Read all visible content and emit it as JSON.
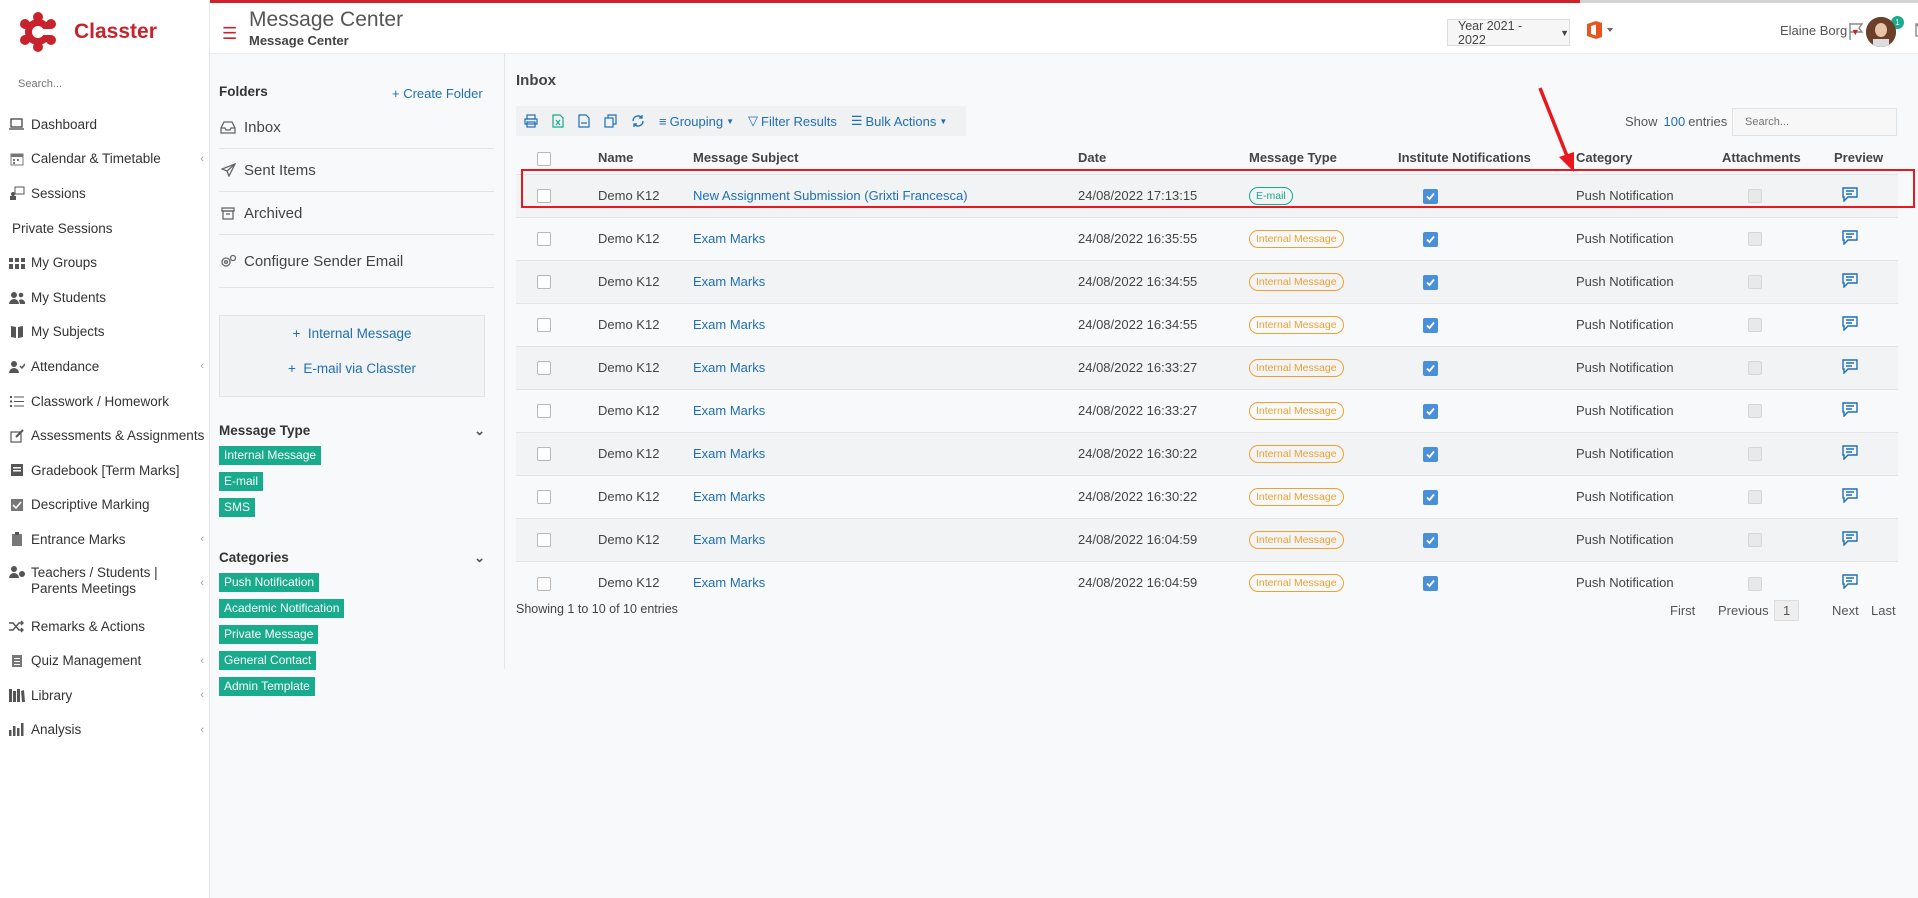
{
  "app": {
    "name": "Classter"
  },
  "sidebar": {
    "search_placeholder": "Search...",
    "items": [
      {
        "label": "Dashboard",
        "icon": "laptop-icon",
        "chevron": false
      },
      {
        "label": "Calendar & Timetable",
        "icon": "calendar-icon",
        "chevron": true
      },
      {
        "label": "Sessions",
        "icon": "presentation-icon",
        "chevron": false
      },
      {
        "label": "Private Sessions",
        "icon": "",
        "chevron": false
      },
      {
        "label": "My Groups",
        "icon": "groups-icon",
        "chevron": false
      },
      {
        "label": "My Students",
        "icon": "users-icon",
        "chevron": false
      },
      {
        "label": "My Subjects",
        "icon": "book-icon",
        "chevron": false
      },
      {
        "label": "Attendance",
        "icon": "attendance-icon",
        "chevron": true
      },
      {
        "label": "Classwork / Homework",
        "icon": "list-icon",
        "chevron": false
      },
      {
        "label": "Assessments & Assignments",
        "icon": "edit-icon",
        "chevron": false
      },
      {
        "label": "Gradebook [Term Marks]",
        "icon": "gradebook-icon",
        "chevron": false
      },
      {
        "label": "Descriptive Marking",
        "icon": "check-square-icon",
        "chevron": false
      },
      {
        "label": "Entrance Marks",
        "icon": "clipboard-icon",
        "chevron": true
      },
      {
        "label": "Teachers / Students | Parents Meetings",
        "icon": "meeting-icon",
        "chevron": true
      },
      {
        "label": "Remarks & Actions",
        "icon": "shuffle-icon",
        "chevron": false
      },
      {
        "label": "Quiz Management",
        "icon": "quiz-icon",
        "chevron": true
      },
      {
        "label": "Library",
        "icon": "library-icon",
        "chevron": true
      },
      {
        "label": "Analysis",
        "icon": "bar-chart-icon",
        "chevron": true
      }
    ]
  },
  "header": {
    "title": "Message Center",
    "subtitle": "Message Center",
    "year": "Year 2021 - 2022",
    "notifications_count": "1",
    "messages_count": "0",
    "user_name": "Elaine Borg"
  },
  "folders": {
    "title": "Folders",
    "create_label": "Create Folder",
    "items": [
      {
        "label": "Inbox",
        "icon": "inbox-icon"
      },
      {
        "label": "Sent Items",
        "icon": "send-icon"
      },
      {
        "label": "Archived",
        "icon": "archive-icon"
      },
      {
        "label": "Configure Sender Email",
        "icon": "gears-icon"
      }
    ],
    "new_internal": "Internal Message",
    "new_email": "E-mail via Classter",
    "message_type_title": "Message Type",
    "message_types": [
      "Internal Message",
      "E-mail",
      "SMS"
    ],
    "categories_title": "Categories",
    "categories": [
      "Push Notification",
      "Academic Notification",
      "Private Message",
      "General Contact",
      "Admin Template"
    ]
  },
  "inbox": {
    "title": "Inbox",
    "toolbar": {
      "grouping": "Grouping",
      "filter": "Filter Results",
      "bulk": "Bulk Actions"
    },
    "show_label": "Show",
    "show_value": "100",
    "entries_label": "entries",
    "search_placeholder": "Search...",
    "columns": [
      "Name",
      "Message Subject",
      "Date",
      "Message Type",
      "Institute Notifications",
      "Category",
      "Attachments",
      "Preview"
    ],
    "rows": [
      {
        "name": "Demo K12",
        "subject": "New Assignment Submission (Grixti Francesca)",
        "date": "24/08/2022 17:13:15",
        "type": "E-mail",
        "kind": "email",
        "category": "Push Notification"
      },
      {
        "name": "Demo K12",
        "subject": "Exam Marks",
        "date": "24/08/2022 16:35:55",
        "type": "Internal Message",
        "kind": "internal",
        "category": "Push Notification"
      },
      {
        "name": "Demo K12",
        "subject": "Exam Marks",
        "date": "24/08/2022 16:34:55",
        "type": "Internal Message",
        "kind": "internal",
        "category": "Push Notification"
      },
      {
        "name": "Demo K12",
        "subject": "Exam Marks",
        "date": "24/08/2022 16:34:55",
        "type": "Internal Message",
        "kind": "internal",
        "category": "Push Notification"
      },
      {
        "name": "Demo K12",
        "subject": "Exam Marks",
        "date": "24/08/2022 16:33:27",
        "type": "Internal Message",
        "kind": "internal",
        "category": "Push Notification"
      },
      {
        "name": "Demo K12",
        "subject": "Exam Marks",
        "date": "24/08/2022 16:33:27",
        "type": "Internal Message",
        "kind": "internal",
        "category": "Push Notification"
      },
      {
        "name": "Demo K12",
        "subject": "Exam Marks",
        "date": "24/08/2022 16:30:22",
        "type": "Internal Message",
        "kind": "internal",
        "category": "Push Notification"
      },
      {
        "name": "Demo K12",
        "subject": "Exam Marks",
        "date": "24/08/2022 16:30:22",
        "type": "Internal Message",
        "kind": "internal",
        "category": "Push Notification"
      },
      {
        "name": "Demo K12",
        "subject": "Exam Marks",
        "date": "24/08/2022 16:04:59",
        "type": "Internal Message",
        "kind": "internal",
        "category": "Push Notification"
      },
      {
        "name": "Demo K12",
        "subject": "Exam Marks",
        "date": "24/08/2022 16:04:59",
        "type": "Internal Message",
        "kind": "internal",
        "category": "Push Notification"
      }
    ],
    "showing": "Showing 1 to 10 of 10 entries",
    "pager": {
      "first": "First",
      "previous": "Previous",
      "current": "1",
      "next": "Next",
      "last": "Last"
    }
  },
  "colors": {
    "brand": "#c8232c",
    "link": "#1e6fb7",
    "tag": "#18ab8c",
    "internal": "#f0a030",
    "highlight": "#e8181e"
  }
}
